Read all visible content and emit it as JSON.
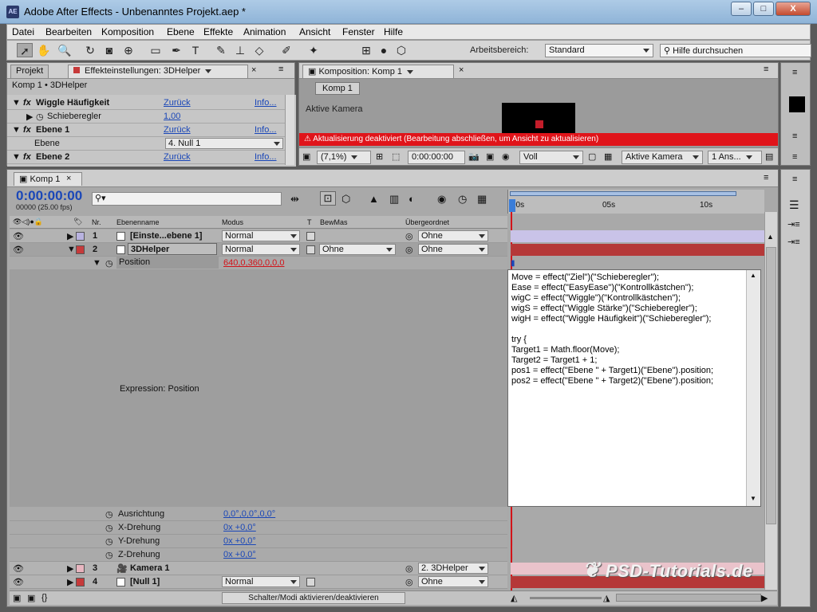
{
  "titlebar": {
    "app_icon": "AE",
    "title": "Adobe After Effects - Unbenanntes Projekt.aep *",
    "minimize": "–",
    "maximize": "□",
    "close": "X"
  },
  "menu": [
    "Datei",
    "Bearbeiten",
    "Komposition",
    "Ebene",
    "Effekte",
    "Animation",
    "Ansicht",
    "Fenster",
    "Hilfe"
  ],
  "toolbar": {
    "workspace_label": "Arbeitsbereich:",
    "workspace_value": "Standard",
    "search_placeholder": "Hilfe durchsuchen"
  },
  "effects_panel": {
    "tab_project": "Projekt",
    "tab_effects": "Effekteinstellungen: 3DHelper",
    "breadcrumb": "Komp 1 • 3DHelper",
    "rows": [
      {
        "label": "Wiggle Häufigkeit",
        "link": "Zurück",
        "info": "Info..."
      },
      {
        "label": "Schieberegler",
        "value": "1,00"
      },
      {
        "label": "Ebene 1",
        "link": "Zurück",
        "info": "Info..."
      },
      {
        "label": "Ebene",
        "select": "4. Null 1"
      },
      {
        "label": "Ebene 2",
        "link": "Zurück",
        "info": "Info..."
      }
    ]
  },
  "comp_panel": {
    "tab": "Komposition: Komp 1",
    "sub_tab": "Komp 1",
    "camera_label": "Aktive Kamera",
    "warning": "Aktualisierung deaktiviert (Bearbeitung abschließen, um Ansicht zu aktualisieren)",
    "zoom": "(7,1%)",
    "timecode": "0:00:00:00",
    "resolution": "Voll",
    "view": "Aktive Kamera",
    "views": "1 Ans..."
  },
  "timeline": {
    "tab": "Komp 1",
    "timecode": "0:00:00:00",
    "fps": "00000 (25.00 fps)",
    "col_nr": "Nr.",
    "col_name": "Ebenenname",
    "col_mode": "Modus",
    "col_t": "T",
    "col_trkmat": "BewMas",
    "col_parent": "Übergeordnet",
    "ruler": [
      "00s",
      "05s",
      "10s"
    ],
    "layers": [
      {
        "nr": "1",
        "name": "[Einste...ebene 1]",
        "mode": "Normal",
        "parent": "Ohne",
        "color": "#b9b3e0"
      },
      {
        "nr": "2",
        "name": "3DHelper",
        "mode": "Normal",
        "trkmat": "Ohne",
        "parent": "Ohne",
        "color": "#c63a3a"
      }
    ],
    "position_label": "Position",
    "position_value": "640,0,360,0,0,0",
    "expression_label": "Expression: Position",
    "props": [
      {
        "label": "Ausrichtung",
        "value": "0,0°,0,0°,0,0°"
      },
      {
        "label": "X-Drehung",
        "value": "0x +0,0°"
      },
      {
        "label": "Y-Drehung",
        "value": "0x +0,0°"
      },
      {
        "label": "Z-Drehung",
        "value": "0x +0,0°"
      }
    ],
    "layers_bottom": [
      {
        "nr": "3",
        "name": "Kamera 1",
        "parent": "2. 3DHelper",
        "color": "#e8b6c0"
      },
      {
        "nr": "4",
        "name": "[Null 1]",
        "mode": "Normal",
        "parent": "Ohne",
        "color": "#c63a3a"
      }
    ],
    "footer_toggle": "Schalter/Modi aktivieren/deaktivieren",
    "expression_lines": [
      "Move = effect(\"Ziel\")(\"Schieberegler\");",
      "Ease = effect(\"EasyEase\")(\"Kontrollkästchen\");",
      "wigC = effect(\"Wiggle\")(\"Kontrollkästchen\");",
      "wigS = effect(\"Wiggle Stärke\")(\"Schieberegler\");",
      "wigH = effect(\"Wiggle Häufigkeit\")(\"Schieberegler\");",
      "",
      "try {",
      "Target1 = Math.floor(Move);",
      "Target2 = Target1 + 1;",
      "pos1 = effect(\"Ebene \" + Target1)(\"Ebene\").position;",
      "pos2 = effect(\"Ebene \" + Target2)(\"Ebene\").position;"
    ]
  },
  "watermark": "PSD-Tutorials.de"
}
